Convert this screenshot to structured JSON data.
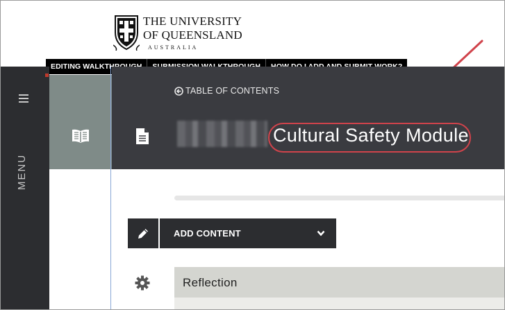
{
  "logo": {
    "line1": "THE UNIVERSITY",
    "line2": "OF QUEENSLAND",
    "line3": "AUSTRALIA"
  },
  "walkthrough_bar": {
    "items": [
      "EDITING WALKTHROUGH",
      "SUBMISSION WALKTHROUGH",
      "HOW DO I ADD AND SUBMIT WORK?"
    ]
  },
  "sidebar": {
    "menu_label": "MENU",
    "icon": "hamburger-icon"
  },
  "header": {
    "toc_label": "TABLE OF CONTENTS",
    "module_title": "Cultural Safety Module",
    "icons": [
      "book-icon",
      "document-icon",
      "arrow-left-circle-icon"
    ]
  },
  "toolbar": {
    "add_content_label": "ADD CONTENT",
    "icons": [
      "pencil-icon",
      "chevron-down-icon"
    ]
  },
  "content": {
    "section_label": "Reflection",
    "icons": [
      "gear-icon"
    ]
  },
  "colors": {
    "dark_bg": "#2c2d30",
    "header_bg": "#3a3b40",
    "book_tile": "#7f8b88",
    "annotation": "#d0434b",
    "section_row": "#d4d5d0"
  }
}
